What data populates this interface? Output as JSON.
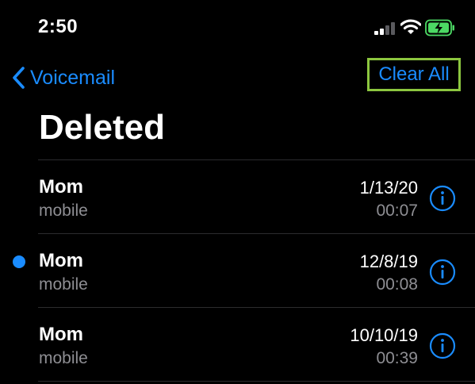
{
  "status_bar": {
    "time": "2:50",
    "signal_icon": "cellular-signal-icon",
    "wifi_icon": "wifi-icon",
    "battery_icon": "battery-charging-icon"
  },
  "nav": {
    "back_label": "Voicemail",
    "back_icon": "chevron-left-icon",
    "clear_label": "Clear All"
  },
  "title": "Deleted",
  "voicemails": [
    {
      "caller": "Mom",
      "label": "mobile",
      "date": "1/13/20",
      "duration": "00:07",
      "unread": false
    },
    {
      "caller": "Mom",
      "label": "mobile",
      "date": "12/8/19",
      "duration": "00:08",
      "unread": true
    },
    {
      "caller": "Mom",
      "label": "mobile",
      "date": "10/10/19",
      "duration": "00:39",
      "unread": false
    }
  ],
  "colors": {
    "accent": "#1a8cff",
    "background": "#000000",
    "secondary_text": "#8e8e93",
    "highlight_border": "#8cc63f",
    "battery_fill": "#4cd964"
  }
}
